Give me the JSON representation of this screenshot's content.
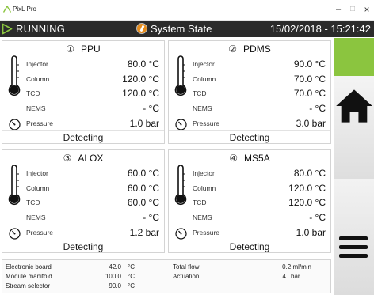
{
  "window": {
    "title": "PixL Pro",
    "minimize": "–",
    "maximize": "□",
    "close": "×"
  },
  "header": {
    "run_state": "RUNNING",
    "system_label": "System State",
    "datetime": "15/02/2018 - 15:21:42"
  },
  "panels": [
    {
      "number": "①",
      "name": "PPU",
      "rows": [
        {
          "label": "Injector",
          "value": "80.0 °C"
        },
        {
          "label": "Column",
          "value": "120.0 °C"
        },
        {
          "label": "TCD",
          "value": "120.0 °C"
        },
        {
          "label": "NEMS",
          "value": "- °C"
        },
        {
          "label": "Pressure",
          "value": "1.0 bar"
        }
      ],
      "status": "Detecting"
    },
    {
      "number": "②",
      "name": "PDMS",
      "rows": [
        {
          "label": "Injector",
          "value": "90.0 °C"
        },
        {
          "label": "Column",
          "value": "70.0 °C"
        },
        {
          "label": "TCD",
          "value": "70.0 °C"
        },
        {
          "label": "NEMS",
          "value": "- °C"
        },
        {
          "label": "Pressure",
          "value": "3.0 bar"
        }
      ],
      "status": "Detecting"
    },
    {
      "number": "③",
      "name": "ALOX",
      "rows": [
        {
          "label": "Injector",
          "value": "60.0 °C"
        },
        {
          "label": "Column",
          "value": "60.0 °C"
        },
        {
          "label": "TCD",
          "value": "60.0 °C"
        },
        {
          "label": "NEMS",
          "value": "- °C"
        },
        {
          "label": "Pressure",
          "value": "1.2 bar"
        }
      ],
      "status": "Detecting"
    },
    {
      "number": "④",
      "name": "MS5A",
      "rows": [
        {
          "label": "Injector",
          "value": "80.0 °C"
        },
        {
          "label": "Column",
          "value": "120.0 °C"
        },
        {
          "label": "TCD",
          "value": "120.0 °C"
        },
        {
          "label": "NEMS",
          "value": "- °C"
        },
        {
          "label": "Pressure",
          "value": "1.0 bar"
        }
      ],
      "status": "Detecting"
    }
  ],
  "info": {
    "electronic_board_label": "Electronic board",
    "electronic_board_value": "42.0",
    "electronic_board_unit": "°C",
    "module_manifold_label": "Module manifold",
    "module_manifold_value": "100.0",
    "module_manifold_unit": "°C",
    "stream_selector_label": "Stream selector",
    "stream_selector_value": "90.0",
    "stream_selector_unit": "°C",
    "total_flow_label": "Total flow",
    "total_flow_value": "0.2 ml/min",
    "actuation_label": "Actuation",
    "actuation_value": "4",
    "actuation_unit": "bar"
  },
  "colors": {
    "header_bg": "#2b2b2b",
    "run_accent": "#8bc53f",
    "status_block": "#8bc53f",
    "system_icon": "#e58b1b"
  },
  "icons": {
    "app": "app-logo-icon",
    "run": "play-icon",
    "system": "system-state-icon",
    "thermometer": "thermometer-icon",
    "pressure": "pressure-gauge-icon",
    "home": "home-icon",
    "menu": "hamburger-menu-icon"
  }
}
